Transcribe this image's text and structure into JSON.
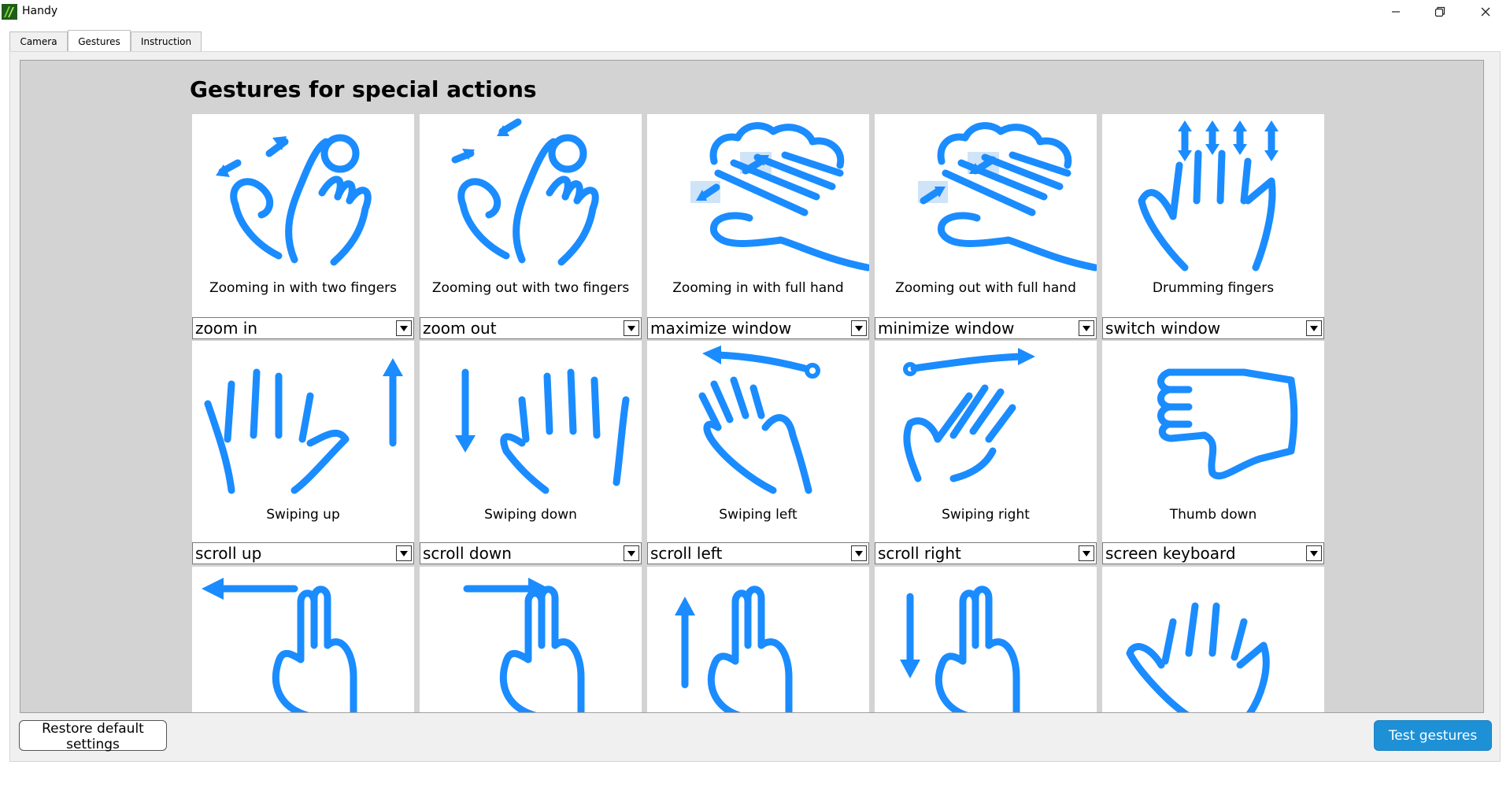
{
  "window": {
    "title": "Handy"
  },
  "tabs": [
    {
      "label": "Camera"
    },
    {
      "label": "Gestures"
    },
    {
      "label": "Instruction"
    }
  ],
  "section_title": "Gestures for special actions",
  "gestures": [
    {
      "label": "Zooming in with two fingers",
      "action": "zoom in",
      "icon": "zoom-in-two-fingers-icon"
    },
    {
      "label": "Zooming out with two fingers",
      "action": "zoom out",
      "icon": "zoom-out-two-fingers-icon"
    },
    {
      "label": "Zooming in with full hand",
      "action": "maximize window",
      "icon": "zoom-in-full-hand-icon"
    },
    {
      "label": "Zooming out with full hand",
      "action": "minimize window",
      "icon": "zoom-out-full-hand-icon"
    },
    {
      "label": "Drumming fingers",
      "action": "switch window",
      "icon": "drumming-fingers-icon"
    },
    {
      "label": "Swiping up",
      "action": "scroll up",
      "icon": "swipe-up-icon"
    },
    {
      "label": "Swiping down",
      "action": "scroll down",
      "icon": "swipe-down-icon"
    },
    {
      "label": "Swiping left",
      "action": "scroll left",
      "icon": "swipe-left-icon"
    },
    {
      "label": "Swiping right",
      "action": "scroll right",
      "icon": "swipe-right-icon"
    },
    {
      "label": "Thumb down",
      "action": "screen keyboard",
      "icon": "thumb-down-icon"
    }
  ],
  "buttons": {
    "restore": "Restore default settings",
    "test": "Test gestures"
  },
  "colors": {
    "icon": "#1a8cff",
    "test_button": "#1e90d6",
    "pane": "#d3d3d3"
  }
}
